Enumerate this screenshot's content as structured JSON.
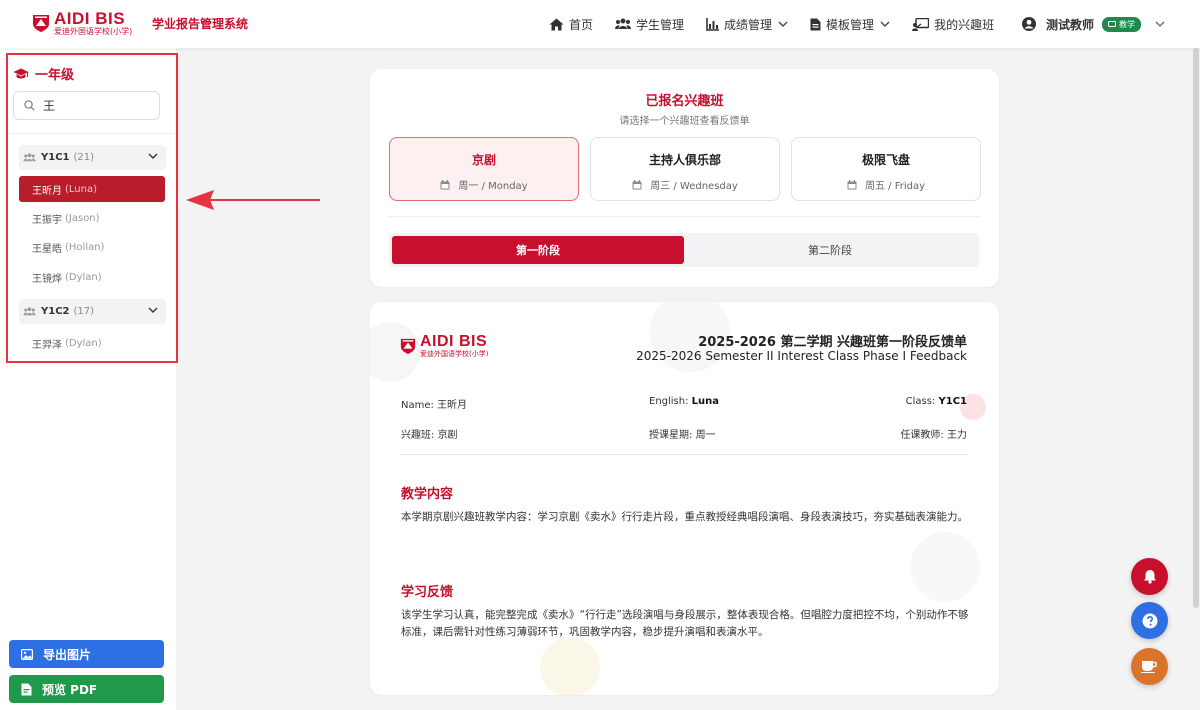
{
  "brand": {
    "logo_main": "AIDI BIS",
    "logo_sub": "爱迪外国语学校(小学)",
    "system_title": "学业报告管理系统",
    "accent": "#c8102e"
  },
  "nav": {
    "items": [
      {
        "label": "首页",
        "icon": "home-icon"
      },
      {
        "label": "学生管理",
        "icon": "users-icon"
      },
      {
        "label": "成绩管理",
        "icon": "chart-icon"
      },
      {
        "label": "模板管理",
        "icon": "file-icon"
      },
      {
        "label": "我的兴趣班",
        "icon": "class-icon"
      }
    ],
    "user_name": "测试教师",
    "user_role": "教学"
  },
  "sidebar": {
    "grade": "一年级",
    "search_value": "王",
    "groups": [
      {
        "name": "Y1C1",
        "count": "(21)"
      },
      {
        "name": "Y1C2",
        "count": "(17)"
      }
    ],
    "students": [
      {
        "cn": "王昕月",
        "en": "(Luna)"
      },
      {
        "cn": "王振宇",
        "en": "(Jason)"
      },
      {
        "cn": "王星皓",
        "en": "(Hollan)"
      },
      {
        "cn": "王镜烨",
        "en": "(Dylan)"
      },
      {
        "cn": "王羿泽",
        "en": "(Dylan)"
      }
    ],
    "export_label": "导出图片",
    "pdf_label": "预览 PDF"
  },
  "classes": {
    "title": "已报名兴趣班",
    "subtitle": "请选择一个兴趣班查看反馈单",
    "items": [
      {
        "name": "京剧",
        "day": "周一 / Monday"
      },
      {
        "name": "主持人俱乐部",
        "day": "周三 / Wednesday"
      },
      {
        "name": "极限飞盘",
        "day": "周五 / Friday"
      }
    ],
    "phases": [
      "第一阶段",
      "第二阶段"
    ]
  },
  "feedback": {
    "title_cn": "2025-2026 第二学期 兴趣班第一阶段反馈单",
    "title_en": "2025-2026 Semester II Interest Class Phase I Feedback",
    "name_label": "Name:",
    "name_value": "王昕月",
    "english_label": "English:",
    "english_value": "Luna",
    "class_label": "Class:",
    "class_value": "Y1C1",
    "course_label": "兴趣班:",
    "course_value": "京剧",
    "day_label": "授课星期:",
    "day_value": "周一",
    "teacher_label": "任课教师:",
    "teacher_value": "王力",
    "content_heading": "教学内容",
    "content_text": "本学期京剧兴趣班教学内容：学习京剧《卖水》行行走片段，重点教授经典唱段演唱、身段表演技巧，夯实基础表演能力。",
    "review_heading": "学习反馈",
    "review_text": "该学生学习认真，能完整完成《卖水》“行行走”选段演唱与身段展示，整体表现合格。但唱腔力度把控不均，个别动作不够标准，课后需针对性练习薄弱环节，巩固教学内容，稳步提升演唱和表演水平。"
  }
}
